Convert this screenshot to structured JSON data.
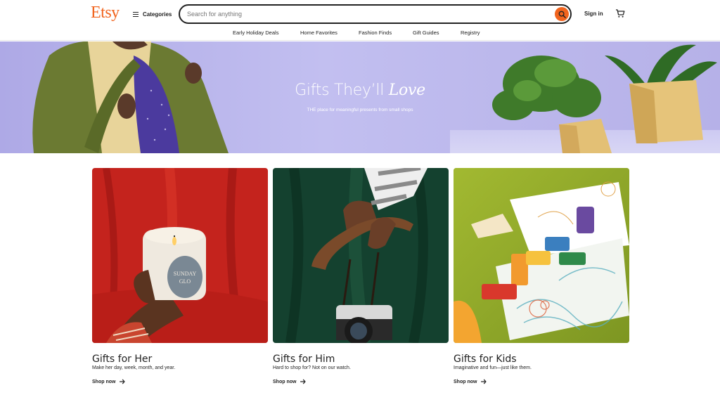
{
  "header": {
    "logo": "Etsy",
    "categories_label": "Categories",
    "search_placeholder": "Search for anything",
    "signin_label": "Sign in"
  },
  "subnav": {
    "items": [
      {
        "label": "Early Holiday Deals"
      },
      {
        "label": "Home Favorites"
      },
      {
        "label": "Fashion Finds"
      },
      {
        "label": "Gift Guides"
      },
      {
        "label": "Registry"
      }
    ]
  },
  "hero": {
    "title_main": "Gifts They’ll",
    "title_accent": "Love",
    "subtitle": "THE place for meaningful presents from small shops"
  },
  "cards": [
    {
      "title": "Gifts for Her",
      "description": "Make her day, week, month, and year.",
      "cta": "Shop now"
    },
    {
      "title": "Gifts for Him",
      "description": "Hard to shop for? Not on our watch.",
      "cta": "Shop now"
    },
    {
      "title": "Gifts for Kids",
      "description": "Imaginative and fun—just like them.",
      "cta": "Shop now"
    }
  ],
  "colors": {
    "brand": "#f1641e",
    "hero_bg": "#b9b5e9",
    "text": "#222222"
  },
  "icons": {
    "categories": "hamburger-icon",
    "search": "search-icon",
    "cart": "cart-icon",
    "cta": "arrow-right-icon"
  }
}
